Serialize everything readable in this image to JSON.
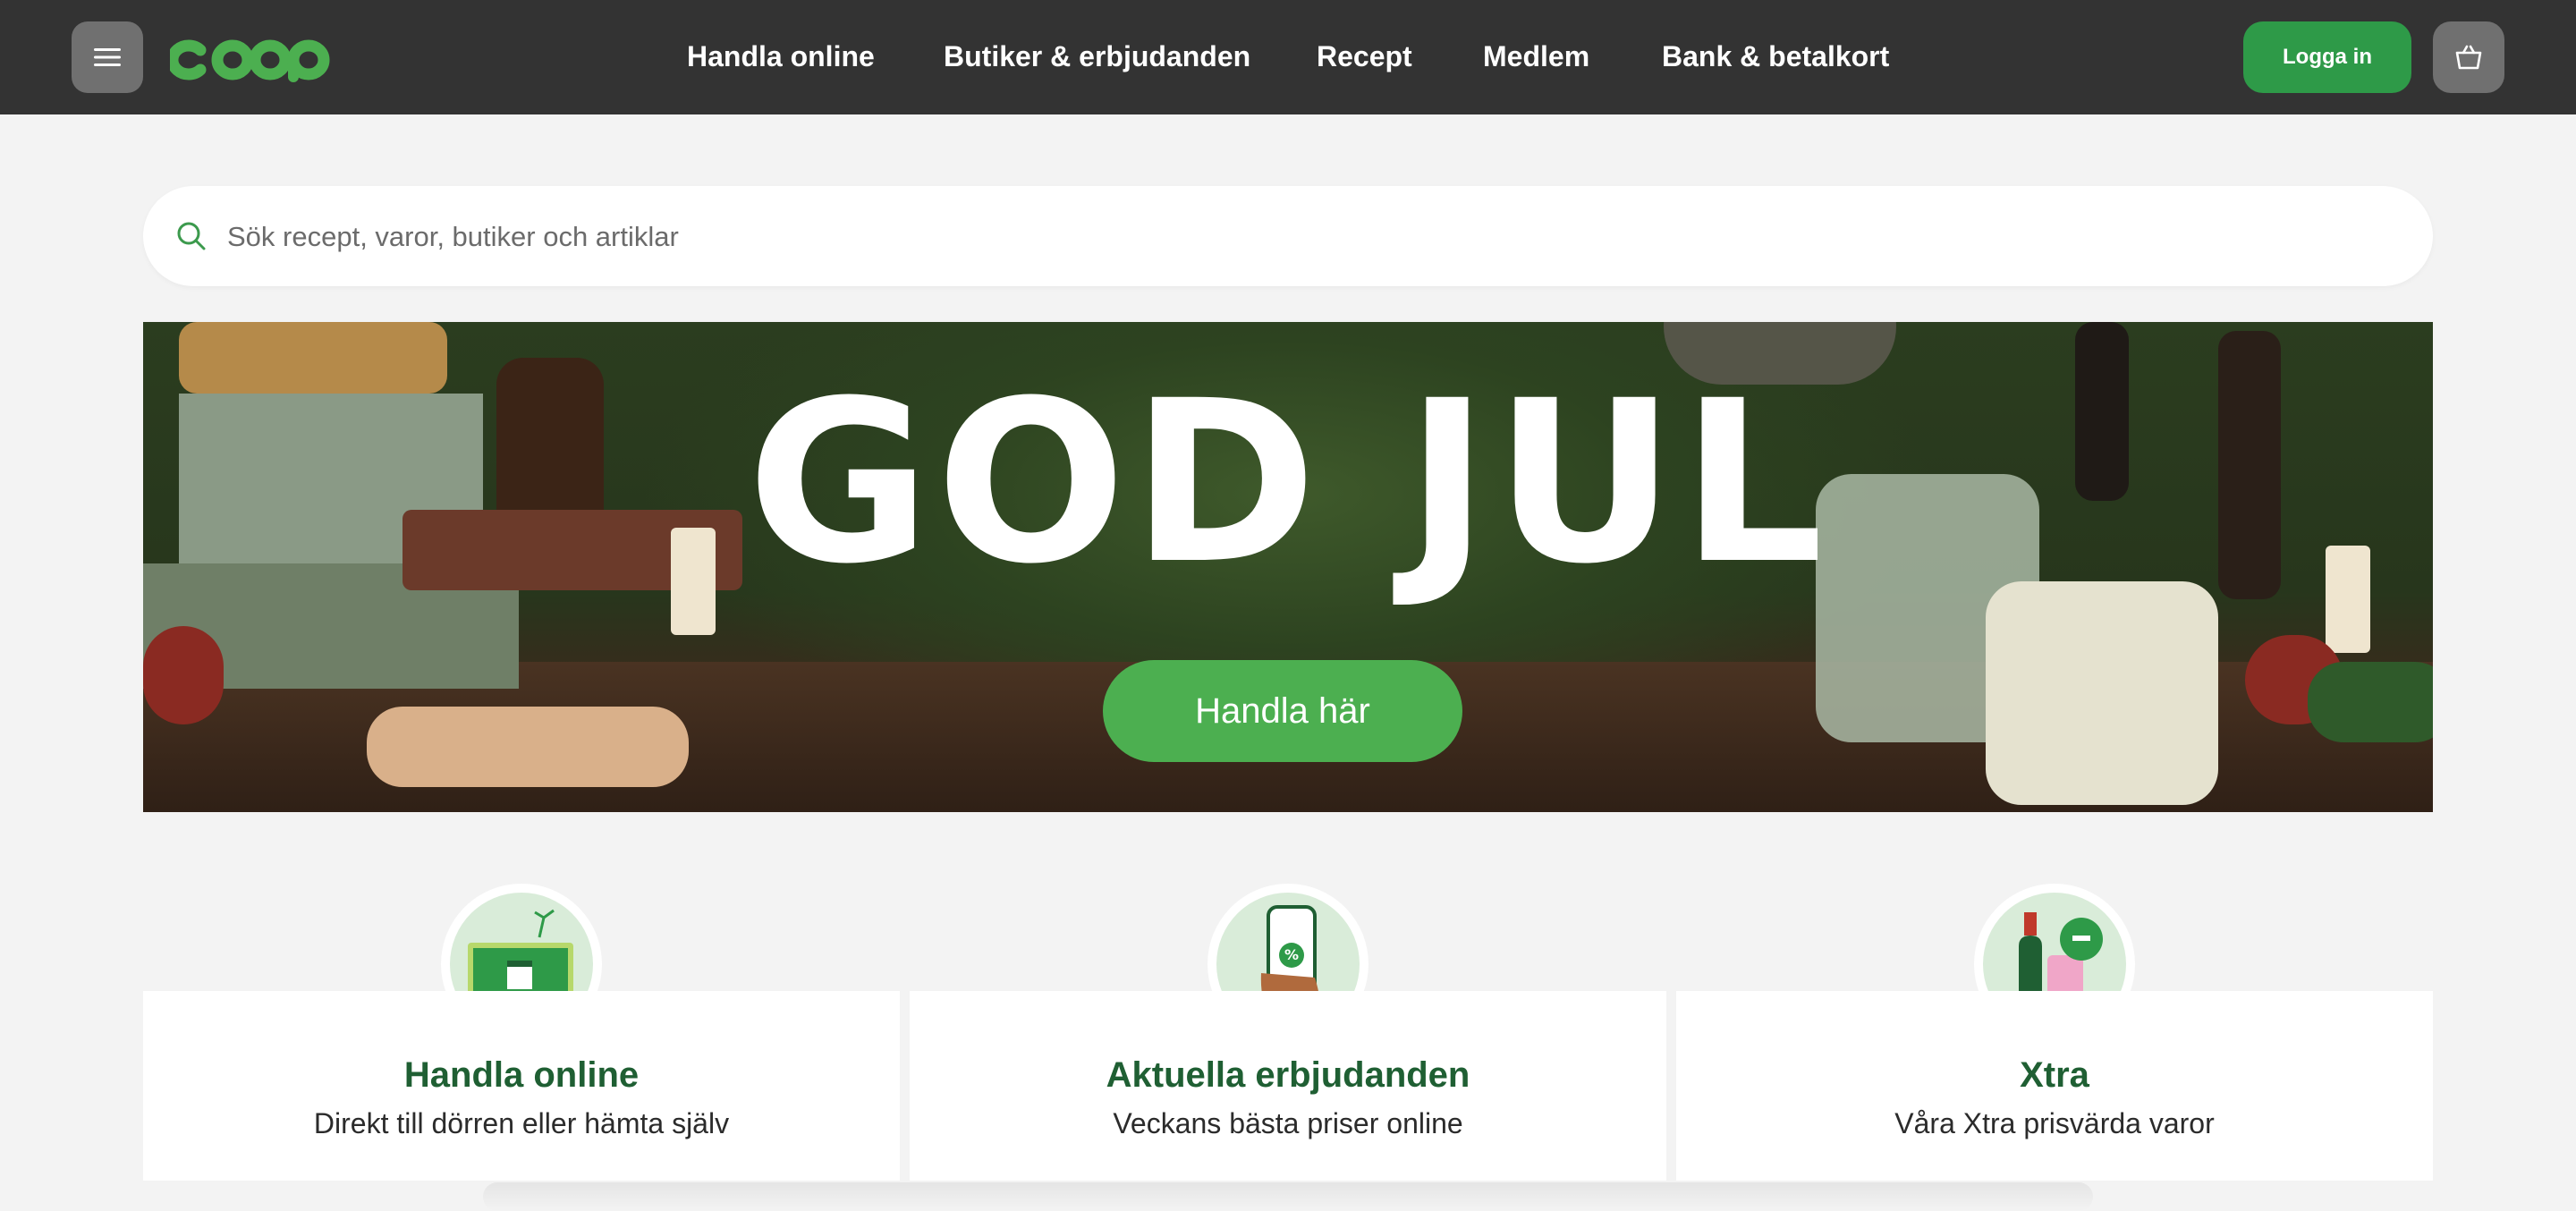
{
  "header": {
    "menu_icon": "hamburger-icon",
    "logo_text": "coop",
    "nav": [
      {
        "label": "Handla online"
      },
      {
        "label": "Butiker & erbjudanden"
      },
      {
        "label": "Recept"
      },
      {
        "label": "Medlem"
      },
      {
        "label": "Bank & betalkort"
      }
    ],
    "login_label": "Logga in",
    "cart_icon": "basket-icon"
  },
  "search": {
    "placeholder": "Sök recept, varor, butiker och artiklar",
    "value": "",
    "icon": "search-icon"
  },
  "hero": {
    "title": "GOD JUL",
    "button_label": "Handla här"
  },
  "cards": [
    {
      "title": "Handla online",
      "subtitle": "Direkt till dörren eller hämta själv",
      "icon": "laptop-shopping-icon"
    },
    {
      "title": "Aktuella erbjudanden",
      "subtitle": "Veckans bästa priser online",
      "icon": "phone-offer-icon"
    },
    {
      "title": "Xtra",
      "subtitle": "Våra Xtra prisvärda varor",
      "icon": "bottles-xtra-icon"
    }
  ],
  "colors": {
    "header_bg": "#333333",
    "brand_green": "#4caf50",
    "login_green": "#2e9a48",
    "card_title_green": "#1f5f33",
    "page_bg": "#f3f3f3"
  }
}
